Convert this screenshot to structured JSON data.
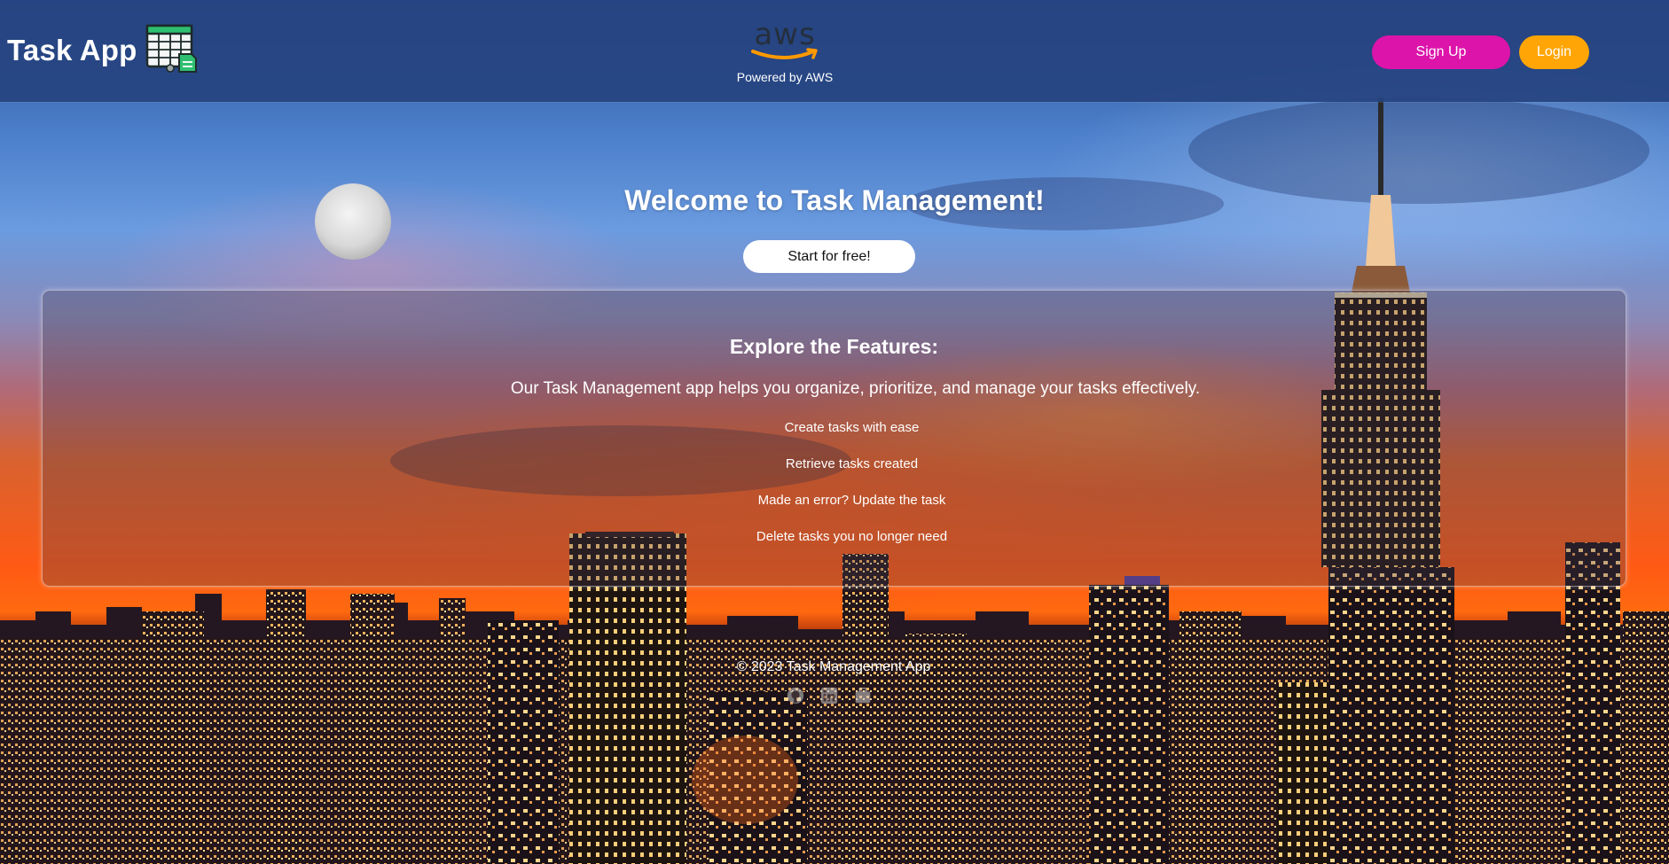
{
  "header": {
    "brand_title": "Task App",
    "aws_logo_text": "aws",
    "powered_by": "Powered by AWS",
    "signup_label": "Sign Up",
    "login_label": "Login"
  },
  "hero": {
    "title": "Welcome to Task Management!",
    "cta_label": "Start for free!"
  },
  "features": {
    "heading": "Explore the Features:",
    "description": "Our Task Management app helps you organize, prioritize, and manage your tasks effectively.",
    "items": [
      "Create tasks with ease",
      "Retrieve tasks created",
      "Made an error? Update the task",
      "Delete tasks you no longer need"
    ]
  },
  "footer": {
    "copyright": "© 2023 Task Management App",
    "icons": [
      "github-icon",
      "linkedin-icon",
      "briefcase-icon"
    ]
  },
  "colors": {
    "header_bg": "#264480",
    "signup_bg": "#dc14aa",
    "login_bg": "#ffa505",
    "aws_orange": "#ff9900"
  }
}
